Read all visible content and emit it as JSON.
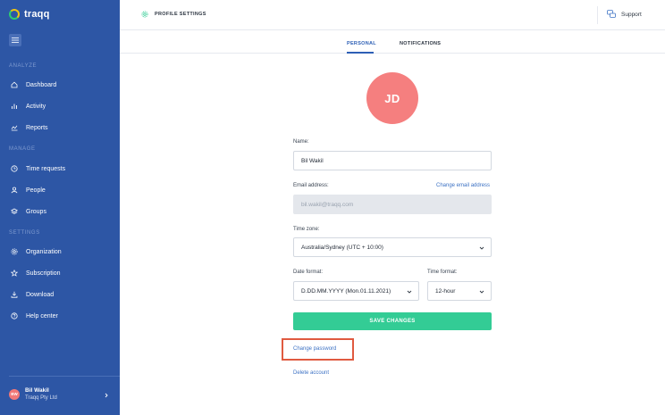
{
  "brand": {
    "name": "traqq"
  },
  "sidebar": {
    "sections": {
      "analyze": "ANALYZE",
      "manage": "MANAGE",
      "settings": "SETTINGS"
    },
    "items": [
      {
        "label": "Dashboard",
        "icon": "home-icon"
      },
      {
        "label": "Activity",
        "icon": "activity-icon"
      },
      {
        "label": "Reports",
        "icon": "reports-icon"
      },
      {
        "label": "Time requests",
        "icon": "clock-icon"
      },
      {
        "label": "People",
        "icon": "people-icon"
      },
      {
        "label": "Groups",
        "icon": "groups-icon"
      },
      {
        "label": "Organization",
        "icon": "gear-icon"
      },
      {
        "label": "Subscription",
        "icon": "star-icon"
      },
      {
        "label": "Download",
        "icon": "download-icon"
      },
      {
        "label": "Help center",
        "icon": "help-icon"
      }
    ],
    "user": {
      "initials": "BW",
      "name": "Bil Wakil",
      "company": "Traqq Pty Ltd"
    }
  },
  "header": {
    "title": "PROFILE SETTINGS",
    "support_label": "Support"
  },
  "tabs": {
    "personal": "PERSONAL",
    "notifications": "NOTIFICATIONS",
    "active": "personal"
  },
  "profile": {
    "avatar_initials": "JD",
    "name_label": "Name:",
    "name_value": "Bil Wakil",
    "email_label": "Email address:",
    "change_email_link": "Change email address",
    "email_value": "bil.wakil@traqq.com",
    "timezone_label": "Time zone:",
    "timezone_value": "Australia/Sydney (UTC + 10:00)",
    "date_format_label": "Date format:",
    "date_format_value": "D.DD.MM.YYYY (Mon.01.11.2021)",
    "time_format_label": "Time format:",
    "time_format_value": "12-hour",
    "save_button": "SAVE CHANGES",
    "change_password_link": "Change password",
    "delete_account_link": "Delete account"
  },
  "colors": {
    "sidebar_bg": "#2d56a5",
    "accent_blue": "#2d5fb5",
    "save_green": "#33cc95",
    "avatar_red": "#f57f7f",
    "highlight_red": "#e05a40"
  }
}
